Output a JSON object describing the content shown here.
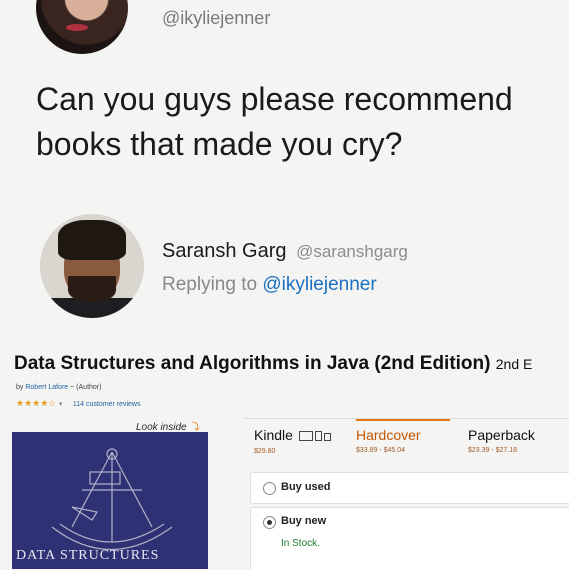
{
  "original_tweet": {
    "handle": "@ikyliejenner",
    "text": "Can you guys please recommend books that made you cry?"
  },
  "reply": {
    "display_name": "Saransh Garg",
    "handle": "@saranshgarg",
    "replying_to_prefix": "Replying to",
    "replying_to_handle": "@ikyliejenner"
  },
  "product": {
    "title": "Data Structures and Algorithms in Java (2nd Edition)",
    "title_suffix": "2nd E",
    "author_prefix": "by",
    "author": "Robert Lafore",
    "author_role": "(Author)",
    "stars": "★★★★☆",
    "reviews": "114 customer reviews",
    "look_inside": "Look inside",
    "cover_text": "DATA STRUCTURES",
    "formats": [
      {
        "label": "Kindle",
        "price": "$29.80"
      },
      {
        "label": "Hardcover",
        "price": "$33.89 - $45.04"
      },
      {
        "label": "Paperback",
        "price": "$23.39 - $27.18"
      }
    ],
    "buy_used": "Buy used",
    "buy_new": "Buy new",
    "stock": "In Stock."
  }
}
